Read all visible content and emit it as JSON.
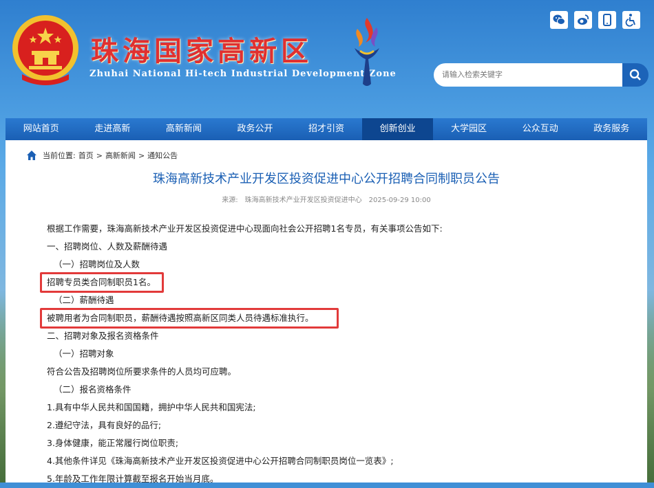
{
  "header": {
    "title_cn": "珠海国家高新区",
    "title_en": "Zhuhai National Hi-tech Industrial Development Zone",
    "top_icons": [
      "wechat-icon",
      "weibo-icon",
      "mobile-icon",
      "accessibility-icon"
    ],
    "search_placeholder": "请输入检索关键字"
  },
  "nav": {
    "items": [
      "网站首页",
      "走进高新",
      "高新新闻",
      "政务公开",
      "招才引资",
      "创新创业",
      "大学园区",
      "公众互动",
      "政务服务"
    ],
    "active": "创新创业"
  },
  "breadcrumb": {
    "prefix": "当前位置:",
    "items": [
      "首页",
      "高新新闻",
      "通知公告"
    ],
    "separator": ">"
  },
  "article": {
    "title": "珠海高新技术产业开发区投资促进中心公开招聘合同制职员公告",
    "source_label": "来源:",
    "source": "珠海高新技术产业开发区投资促进中心",
    "date": "2025-09-29 10:00",
    "paragraphs": [
      "根据工作需要，珠海高新技术产业开发区投资促进中心现面向社会公开招聘1名专员，有关事项公告如下:",
      "一、招聘岗位、人数及薪酬待遇",
      "（一）招聘岗位及人数",
      "招聘专员类合同制职员1名。",
      "（二）薪酬待遇",
      "被聘用者为合同制职员，薪酬待遇按照高新区同类人员待遇标准执行。",
      "二、招聘对象及报名资格条件",
      "（一）招聘对象",
      "符合公告及招聘岗位所要求条件的人员均可应聘。",
      "（二）报名资格条件",
      "1.具有中华人民共和国国籍，拥护中华人民共和国宪法;",
      "2.遵纪守法，具有良好的品行;",
      "3.身体健康，能正常履行岗位职责;",
      "4.其他条件详见《珠海高新技术产业开发区投资促进中心公开招聘合同制职员岗位一览表》;",
      "5.年龄及工作年限计算截至报名开始当月底。"
    ]
  },
  "colors": {
    "nav_bg": "#1a5fb4",
    "nav_active": "#0d4690",
    "title_color": "#1a5fb4",
    "highlight_box": "#e23a3a",
    "brand_red": "#e03030"
  }
}
